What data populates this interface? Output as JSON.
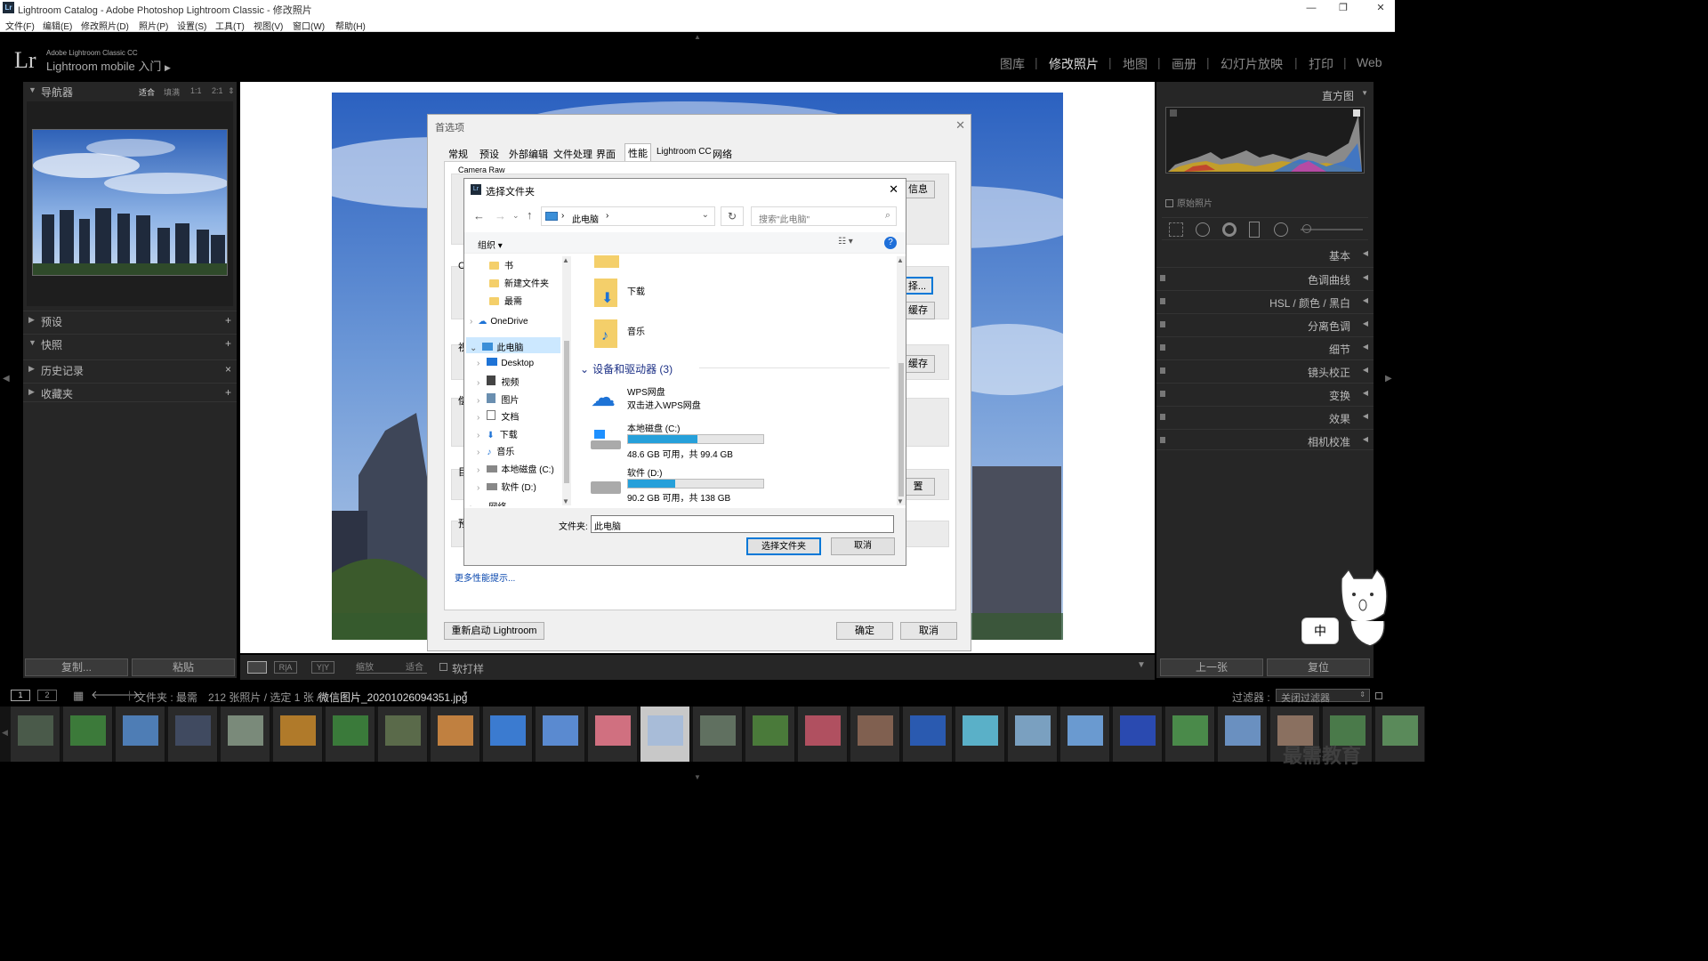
{
  "window": {
    "title": "Lightroom Catalog - Adobe Photoshop Lightroom Classic - 修改照片",
    "app_icon": "Lr"
  },
  "menu": [
    "文件(F)",
    "编辑(E)",
    "修改照片(D)",
    "照片(P)",
    "设置(S)",
    "工具(T)",
    "视图(V)",
    "窗口(W)",
    "帮助(H)"
  ],
  "identity": {
    "logo": "Lr",
    "product": "Adobe Lightroom Classic CC",
    "mobile": "Lightroom mobile 入门",
    "play": "▶"
  },
  "modules": [
    "图库",
    "修改照片",
    "地图",
    "画册",
    "幻灯片放映",
    "打印",
    "Web"
  ],
  "active_module": "修改照片",
  "left_panel": {
    "navigator": {
      "label": "导航器",
      "options": [
        "适合",
        "填满",
        "1:1",
        "2:1"
      ]
    },
    "sections": [
      {
        "label": "预设",
        "action": "+"
      },
      {
        "label": "快照",
        "action": "+"
      },
      {
        "label": "历史记录",
        "action": "×"
      },
      {
        "label": "收藏夹",
        "action": "+"
      }
    ],
    "copy_button": "复制...",
    "paste_button": "粘贴"
  },
  "right_panel": {
    "histogram": "直方图",
    "original_photo": "原始照片",
    "sections": [
      "基本",
      "色调曲线",
      "HSL / 颜色 / 黑白",
      "分离色调",
      "细节",
      "镜头校正",
      "变换",
      "效果",
      "相机校准"
    ],
    "prev_button": "上一张",
    "reset_button": "复位"
  },
  "toolbar": {
    "zoom_label": "缩放",
    "zoom_value": "适合",
    "soft_proof": "软打样",
    "view_ra": "R|A",
    "view_yy": "Y|Y"
  },
  "filmstrip_bar": {
    "page1": "1",
    "page2": "2",
    "source": "文件夹 : 最需",
    "count": "212 张照片 / 选定 1 张 /",
    "filename": "微信图片_20201026094351.jpg",
    "filter_label": "过滤器 :",
    "filter_value": "关闭过滤器"
  },
  "prefs_dialog": {
    "title": "首选项",
    "tabs": [
      "常规",
      "预设",
      "外部编辑",
      "文件处理",
      "界面",
      "性能",
      "Lightroom CC",
      "网络"
    ],
    "active_tab": "性能",
    "camera_raw": "Camera Raw",
    "partial_labels": [
      "Ca",
      "视",
      "偿",
      "目",
      "预"
    ],
    "info_button": "信息",
    "select_button": "择...",
    "cache_button1": "缓存",
    "cache_button2": "缓存",
    "misc_button": "置",
    "more_tips": "更多性能提示...",
    "restart_button": "重新启动 Lightroom",
    "ok_button": "确定",
    "cancel_button": "取消"
  },
  "chooser": {
    "title": "选择文件夹",
    "address": "此电脑",
    "search_placeholder": "搜索\"此电脑\"",
    "organize": "组织 ▾",
    "tree": [
      {
        "label": "书",
        "indent": 2
      },
      {
        "label": "新建文件夹",
        "indent": 2
      },
      {
        "label": "最需",
        "indent": 2
      },
      {
        "label": "OneDrive",
        "indent": 0
      },
      {
        "label": "此电脑",
        "indent": 0
      },
      {
        "label": "Desktop",
        "indent": 1
      },
      {
        "label": "视频",
        "indent": 1
      },
      {
        "label": "图片",
        "indent": 1
      },
      {
        "label": "文档",
        "indent": 1
      },
      {
        "label": "下载",
        "indent": 1
      },
      {
        "label": "音乐",
        "indent": 1
      },
      {
        "label": "本地磁盘 (C:)",
        "indent": 1
      },
      {
        "label": "软件 (D:)",
        "indent": 1
      },
      {
        "label": "网络",
        "indent": 0
      }
    ],
    "folders": [
      "下载",
      "音乐"
    ],
    "group_header": "设备和驱动器 (3)",
    "drives": [
      {
        "name": "WPS网盘",
        "sub": "双击进入WPS网盘"
      },
      {
        "name": "本地磁盘 (C:)",
        "sub": "48.6 GB 可用，共 99.4 GB",
        "used_fraction": 0.51
      },
      {
        "name": "软件 (D:)",
        "sub": "90.2 GB 可用，共 138 GB",
        "used_fraction": 0.35
      }
    ],
    "folder_label": "文件夹:",
    "folder_value": "此电脑",
    "select_button": "选择文件夹",
    "cancel_button": "取消"
  },
  "overlay": {
    "ime": "中",
    "watermark": "最需教育"
  },
  "colors": {
    "accent": "#26a0da",
    "lr_bg": "#262626"
  }
}
